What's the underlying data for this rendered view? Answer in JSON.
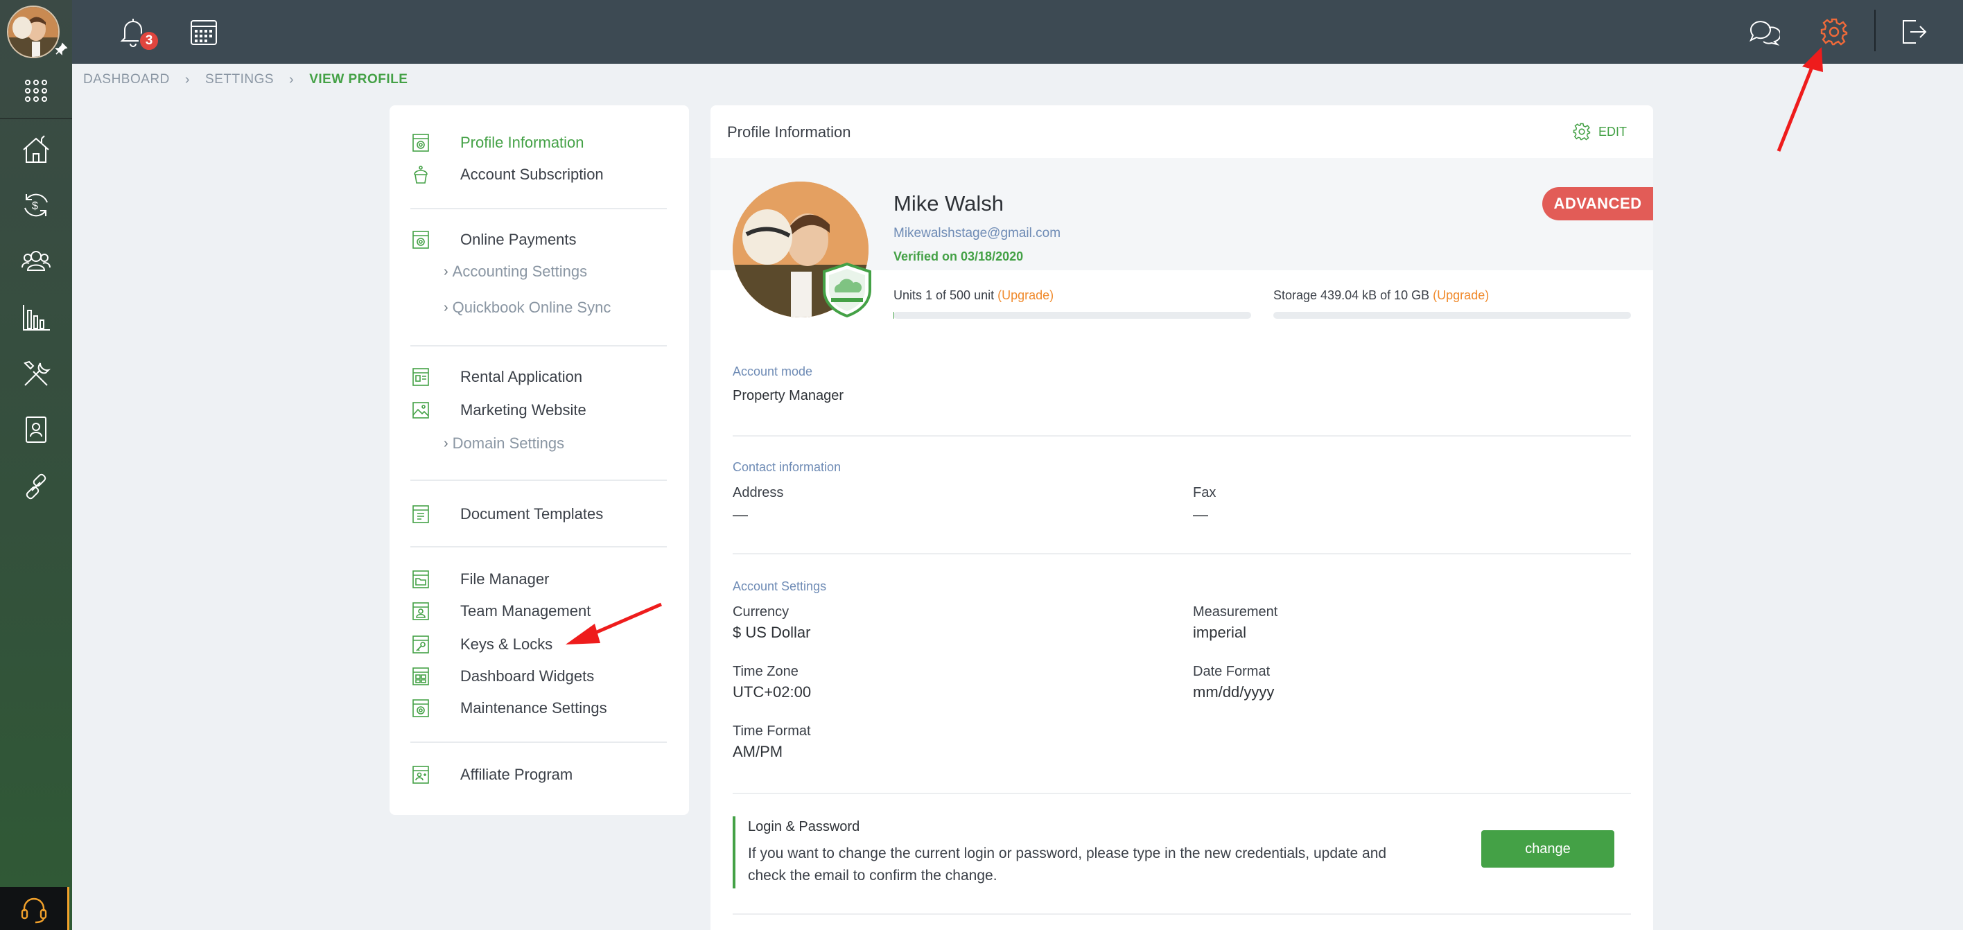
{
  "topbar": {
    "notifications_count": "3"
  },
  "breadcrumb": {
    "items": [
      "DASHBOARD",
      "SETTINGS",
      "VIEW PROFILE"
    ]
  },
  "settings_menu": {
    "groups": [
      {
        "items": [
          {
            "label": "Profile Information",
            "active": true
          },
          {
            "label": "Account Subscription"
          }
        ]
      },
      {
        "items": [
          {
            "label": "Online Payments"
          }
        ],
        "subitems": [
          "Accounting Settings",
          "Quickbook Online Sync"
        ]
      },
      {
        "items": [
          {
            "label": "Rental Application"
          },
          {
            "label": "Marketing Website"
          }
        ],
        "subitems": [
          "Domain Settings"
        ]
      },
      {
        "items": [
          {
            "label": "Document Templates"
          }
        ]
      },
      {
        "items": [
          {
            "label": "File Manager"
          },
          {
            "label": "Team Management"
          },
          {
            "label": "Keys & Locks"
          },
          {
            "label": "Dashboard Widgets"
          },
          {
            "label": "Maintenance Settings"
          }
        ]
      },
      {
        "items": [
          {
            "label": "Affiliate Program"
          }
        ]
      }
    ]
  },
  "profile": {
    "title": "Profile Information",
    "edit_label": "EDIT",
    "name": "Mike Walsh",
    "email": "Mikewalshstage@gmail.com",
    "verified": "Verified on 03/18/2020",
    "plan_badge": "ADVANCED",
    "units": {
      "text": "Units 1 of 500 unit",
      "upgrade": "(Upgrade)",
      "fraction": 0.002
    },
    "storage": {
      "text": "Storage 439.04 kB of 10 GB",
      "upgrade": "(Upgrade)",
      "fraction": 4e-05
    },
    "account_mode": {
      "section": "Account mode",
      "value": "Property Manager"
    },
    "contact": {
      "section": "Contact information",
      "address_label": "Address",
      "address_value": "—",
      "fax_label": "Fax",
      "fax_value": "—"
    },
    "account_settings": {
      "section": "Account Settings",
      "currency_label": "Currency",
      "currency_value": "$ US Dollar",
      "measurement_label": "Measurement",
      "measurement_value": "imperial",
      "timezone_label": "Time Zone",
      "timezone_value": "UTC+02:00",
      "dateformat_label": "Date Format",
      "dateformat_value": "mm/dd/yyyy",
      "timeformat_label": "Time Format",
      "timeformat_value": "AM/PM"
    },
    "login": {
      "title": "Login & Password",
      "description": "If you want to change the current login or password, please type in the new credentials, update and check the email to confirm the change.",
      "button": "change"
    }
  },
  "colors": {
    "accent_green": "#44a146",
    "upgrade_orange": "#f08a2c",
    "badge_red": "#e25c57",
    "settings_icon_active": "#f06a3a",
    "annotation_arrow": "#ee1c1c"
  }
}
